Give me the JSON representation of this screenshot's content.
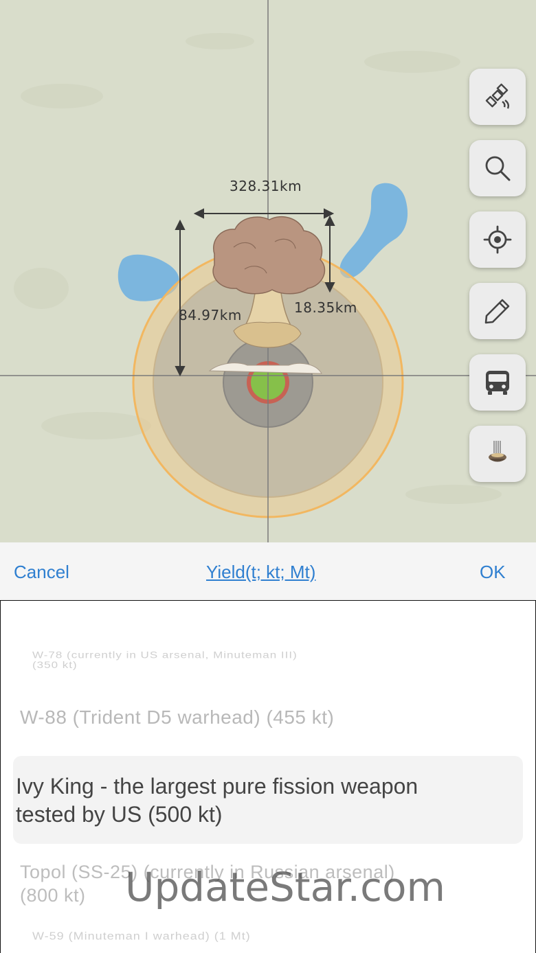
{
  "map": {
    "measurements": {
      "width": "328.31km",
      "height": "84.97km",
      "stem": "18.35km"
    },
    "colors": {
      "land": "#d9ddcb",
      "water": "#7cb6de",
      "thermal_ring": "#f2b760",
      "cloud": "#b99580"
    }
  },
  "side_buttons": [
    {
      "name": "satellite-button",
      "icon": "satellite-icon"
    },
    {
      "name": "search-button",
      "icon": "search-icon"
    },
    {
      "name": "locate-button",
      "icon": "crosshair-icon"
    },
    {
      "name": "edit-button",
      "icon": "pencil-icon"
    },
    {
      "name": "transport-button",
      "icon": "bus-icon"
    },
    {
      "name": "bomb-button",
      "icon": "bomb-icon"
    }
  ],
  "toolbar": {
    "cancel": "Cancel",
    "title": "Yield(t; kt; Mt)",
    "ok": "OK"
  },
  "picker": {
    "options": [
      {
        "label_line1": "W-78 (currently in US arsenal, Minuteman III)",
        "label_line2": "(350 kt)"
      },
      {
        "label": "W-88 (Trident D5 warhead) (455 kt)"
      },
      {
        "label_line1": "Ivy King - the largest pure fission weapon",
        "label_line2": "tested by US (500 kt)",
        "selected": true
      },
      {
        "label_line1": "Topol (SS-25) (currently in Russian arsenal)",
        "label_line2": "(800 kt)"
      },
      {
        "label": "W-59 (Minuteman I warhead) (1 Mt)"
      }
    ]
  },
  "watermark": "UpdateStar.com"
}
